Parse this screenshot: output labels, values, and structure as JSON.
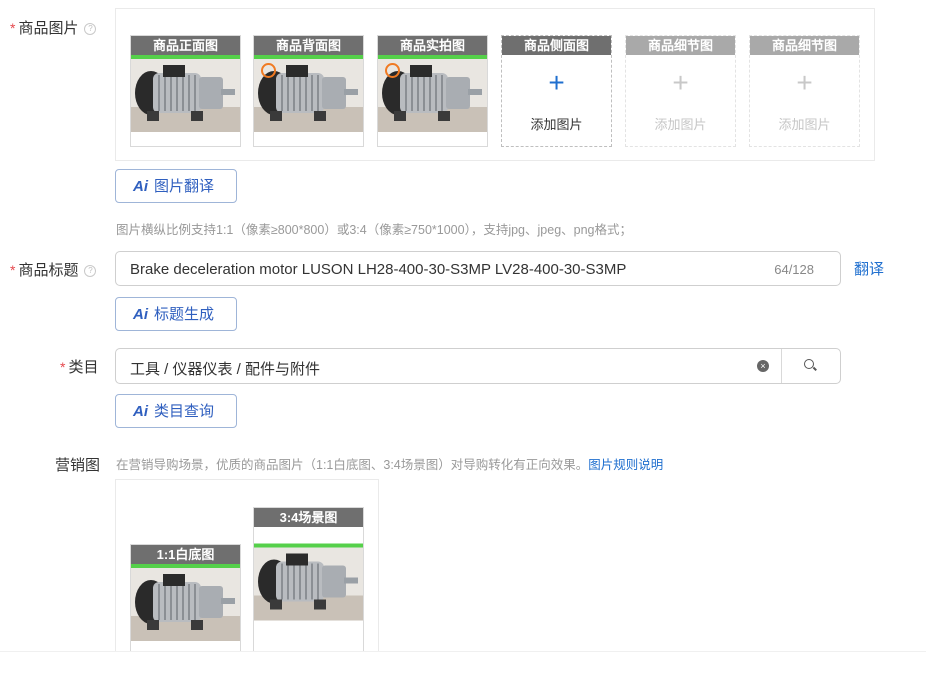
{
  "images": {
    "label": "商品图片",
    "help": "?",
    "thumbs": [
      {
        "caption": "商品正面图",
        "icon": "motor-photo"
      },
      {
        "caption": "商品背面图",
        "icon": "motor-photo"
      },
      {
        "caption": "商品实拍图",
        "icon": "motor-photo"
      }
    ],
    "add_slots": [
      {
        "caption": "商品侧面图",
        "text": "添加图片",
        "plus": "+"
      },
      {
        "caption": "商品细节图",
        "text": "添加图片",
        "plus": "+"
      },
      {
        "caption": "商品细节图",
        "text": "添加图片",
        "plus": "+"
      }
    ],
    "ai_button": {
      "ai": "Ai",
      "label": "图片翻译"
    },
    "hint": "图片横纵比例支持1:1（像素≥800*800）或3:4（像素≥750*1000），支持jpg、jpeg、png格式；"
  },
  "title": {
    "label": "商品标题",
    "help": "?",
    "value": "Brake deceleration motor LUSON LH28-400-30-S3MP LV28-400-30-S3MP",
    "counter": "64/128",
    "translate": "翻译",
    "ai_button": {
      "ai": "Ai",
      "label": "标题生成"
    }
  },
  "category": {
    "label": "类目",
    "value": "工具 / 仪器仪表 / 配件与附件",
    "ai_button": {
      "ai": "Ai",
      "label": "类目查询"
    }
  },
  "marketing": {
    "label": "营销图",
    "hint": "在营销导购场景，优质的商品图片（1:1白底图、3:4场景图）对导购转化有正向效果。",
    "link": "图片规则说明",
    "thumbs": [
      {
        "caption": "1:1白底图"
      },
      {
        "caption": "3:4场景图"
      }
    ]
  },
  "colors": {
    "accent": "#1f6fcf",
    "required": "#e5484d",
    "caption_bg": "#6f6f6f"
  }
}
